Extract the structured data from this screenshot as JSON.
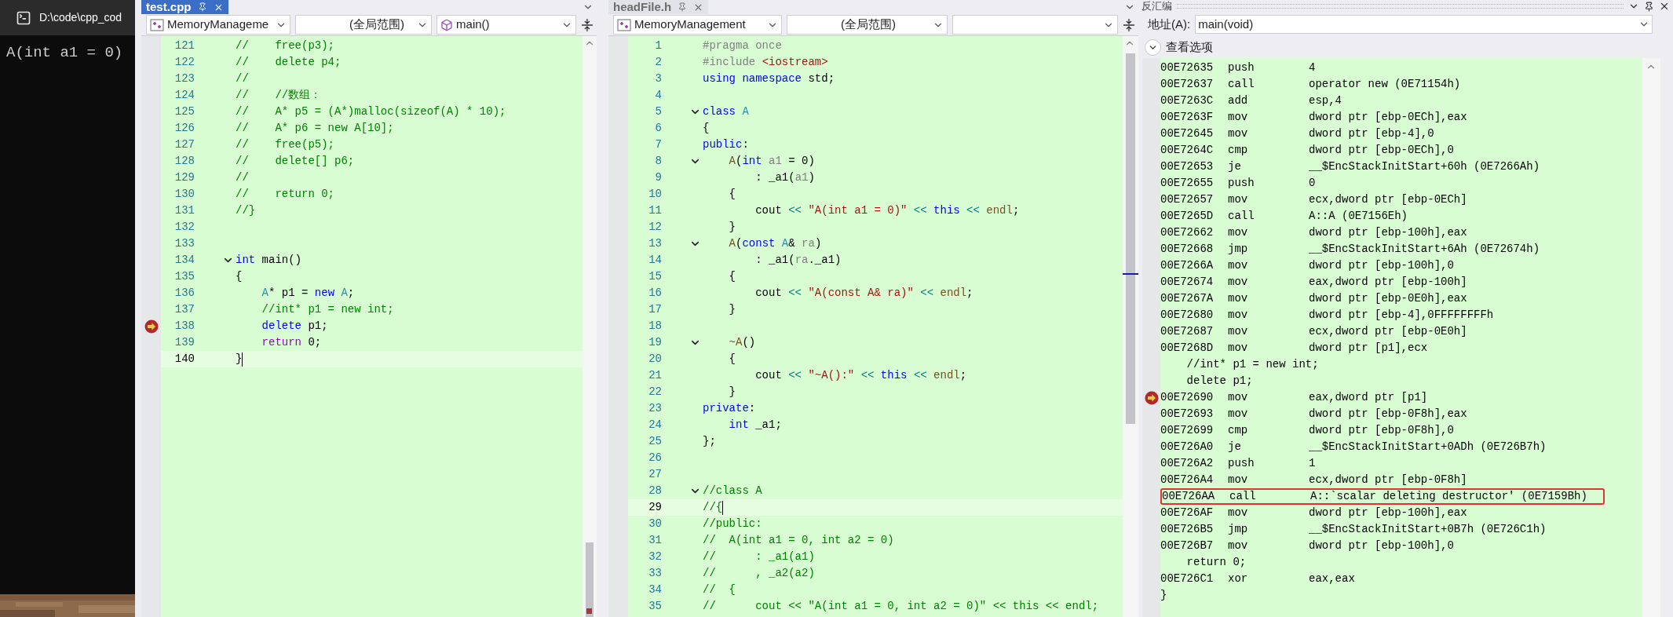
{
  "console": {
    "title": "D:\\code\\cpp_cod",
    "output": "A(int a1 = 0)"
  },
  "editors": [
    {
      "tab": {
        "label": "test.cpp",
        "selected": true
      },
      "nav": [
        {
          "kind": "project",
          "text": "MemoryManageme"
        },
        {
          "kind": "scope",
          "text": "(全局范围)"
        },
        {
          "kind": "function",
          "text": "main()"
        }
      ],
      "lines": [
        {
          "number": "121",
          "fold": false,
          "current": false,
          "selected": false,
          "tokens": [
            {
              "kind": "comment",
              "text": "//    free(p3);"
            }
          ]
        },
        {
          "number": "122",
          "fold": false,
          "current": false,
          "selected": false,
          "tokens": [
            {
              "kind": "comment",
              "text": "//    delete p4;"
            }
          ]
        },
        {
          "number": "123",
          "fold": false,
          "current": false,
          "selected": false,
          "tokens": [
            {
              "kind": "comment",
              "text": "//"
            }
          ]
        },
        {
          "number": "124",
          "fold": false,
          "current": false,
          "selected": false,
          "tokens": [
            {
              "kind": "comment",
              "text": "//    //数组："
            }
          ]
        },
        {
          "number": "125",
          "fold": false,
          "current": false,
          "selected": false,
          "tokens": [
            {
              "kind": "comment",
              "text": "//    A* p5 = (A*)malloc(sizeof(A) * 10);"
            }
          ]
        },
        {
          "number": "126",
          "fold": false,
          "current": false,
          "selected": false,
          "tokens": [
            {
              "kind": "comment",
              "text": "//    A* p6 = new A[10];"
            }
          ]
        },
        {
          "number": "127",
          "fold": false,
          "current": false,
          "selected": false,
          "tokens": [
            {
              "kind": "comment",
              "text": "//    free(p5);"
            }
          ]
        },
        {
          "number": "128",
          "fold": false,
          "current": false,
          "selected": false,
          "tokens": [
            {
              "kind": "comment",
              "text": "//    delete[] p6;"
            }
          ]
        },
        {
          "number": "129",
          "fold": false,
          "current": false,
          "selected": false,
          "tokens": [
            {
              "kind": "comment",
              "text": "//"
            }
          ]
        },
        {
          "number": "130",
          "fold": false,
          "current": false,
          "selected": false,
          "tokens": [
            {
              "kind": "comment",
              "text": "//    return 0;"
            }
          ]
        },
        {
          "number": "131",
          "fold": false,
          "current": false,
          "selected": false,
          "tokens": [
            {
              "kind": "comment",
              "text": "//}"
            }
          ]
        },
        {
          "number": "132",
          "fold": false,
          "current": false,
          "selected": false
        },
        {
          "number": "133",
          "fold": false,
          "current": false,
          "selected": false
        },
        {
          "number": "134",
          "fold": true,
          "current": false,
          "selected": false,
          "tokens": [
            {
              "kind": "keyword",
              "text": "int"
            },
            {
              "kind": "plain",
              "text": " main()"
            }
          ]
        },
        {
          "number": "135",
          "fold": false,
          "current": false,
          "selected": false,
          "tokens": [
            {
              "kind": "plain",
              "text": "{"
            }
          ]
        },
        {
          "number": "136",
          "fold": false,
          "current": false,
          "selected": false,
          "tokens": [
            {
              "kind": "type",
              "text": "    A"
            },
            {
              "kind": "plain",
              "text": "* p1 = "
            },
            {
              "kind": "keyword",
              "text": "new"
            },
            {
              "kind": "type",
              "text": " A"
            },
            {
              "kind": "plain",
              "text": ";"
            }
          ]
        },
        {
          "number": "137",
          "fold": false,
          "current": false,
          "selected": false,
          "tokens": [
            {
              "kind": "comment",
              "text": "    //int* p1 = new int;"
            }
          ]
        },
        {
          "number": "138",
          "fold": false,
          "current": true,
          "selected": false,
          "tokens": [
            {
              "kind": "keyword",
              "text": "    delete"
            },
            {
              "kind": "plain",
              "text": " p1;"
            }
          ]
        },
        {
          "number": "139",
          "fold": false,
          "current": false,
          "selected": false,
          "tokens": [
            {
              "kind": "control",
              "text": "    return"
            },
            {
              "kind": "plain",
              "text": " 0;"
            }
          ]
        },
        {
          "number": "140",
          "fold": false,
          "current": false,
          "selected": true,
          "tokens": [
            {
              "kind": "plain",
              "text": "}"
            }
          ]
        }
      ]
    },
    {
      "tab": {
        "label": "headFile.h",
        "selected": false
      },
      "nav": [
        {
          "kind": "project",
          "text": "MemoryManagement"
        },
        {
          "kind": "scope",
          "text": "(全局范围)"
        }
      ],
      "lines": [
        {
          "number": "1",
          "fold": false,
          "current": false,
          "selected": false,
          "tokens": [
            {
              "kind": "preproc",
              "text": "#pragma once"
            }
          ]
        },
        {
          "number": "2",
          "fold": false,
          "current": false,
          "selected": false,
          "tokens": [
            {
              "kind": "preproc",
              "text": "#include "
            },
            {
              "kind": "string",
              "text": "<iostream>"
            }
          ]
        },
        {
          "number": "3",
          "fold": false,
          "current": false,
          "selected": false,
          "tokens": [
            {
              "kind": "keyword",
              "text": "using namespace"
            },
            {
              "kind": "plain",
              "text": " std;"
            }
          ]
        },
        {
          "number": "4",
          "fold": false,
          "current": false,
          "selected": false
        },
        {
          "number": "5",
          "fold": true,
          "current": false,
          "selected": false,
          "tokens": [
            {
              "kind": "keyword",
              "text": "class"
            },
            {
              "kind": "type",
              "text": " A"
            }
          ]
        },
        {
          "number": "6",
          "fold": false,
          "current": false,
          "selected": false,
          "tokens": [
            {
              "kind": "plain",
              "text": "{"
            }
          ]
        },
        {
          "number": "7",
          "fold": false,
          "current": false,
          "selected": false,
          "tokens": [
            {
              "kind": "keyword",
              "text": "public"
            },
            {
              "kind": "plain",
              "text": ":"
            }
          ]
        },
        {
          "number": "8",
          "fold": true,
          "current": false,
          "selected": false,
          "tokens": [
            {
              "kind": "function",
              "text": "    A"
            },
            {
              "kind": "plain",
              "text": "("
            },
            {
              "kind": "keyword",
              "text": "int"
            },
            {
              "kind": "param",
              "text": " a1"
            },
            {
              "kind": "plain",
              "text": " = 0)"
            }
          ]
        },
        {
          "number": "9",
          "fold": false,
          "current": false,
          "selected": false,
          "tokens": [
            {
              "kind": "plain",
              "text": "        : _a1("
            },
            {
              "kind": "param",
              "text": "a1"
            },
            {
              "kind": "plain",
              "text": ")"
            }
          ]
        },
        {
          "number": "10",
          "fold": false,
          "current": false,
          "selected": false,
          "tokens": [
            {
              "kind": "plain",
              "text": "    {"
            }
          ]
        },
        {
          "number": "11",
          "fold": false,
          "current": false,
          "selected": false,
          "tokens": [
            {
              "kind": "plain",
              "text": "        cout "
            },
            {
              "kind": "operator",
              "text": "<<"
            },
            {
              "kind": "string",
              "text": " \"A(int a1 = 0)\""
            },
            {
              "kind": "operator",
              "text": " <<"
            },
            {
              "kind": "keyword",
              "text": " this"
            },
            {
              "kind": "operator",
              "text": " <<"
            },
            {
              "kind": "function",
              "text": " endl"
            },
            {
              "kind": "plain",
              "text": ";"
            }
          ]
        },
        {
          "number": "12",
          "fold": false,
          "current": false,
          "selected": false,
          "tokens": [
            {
              "kind": "plain",
              "text": "    }"
            }
          ]
        },
        {
          "number": "13",
          "fold": true,
          "current": false,
          "selected": false,
          "tokens": [
            {
              "kind": "function",
              "text": "    A"
            },
            {
              "kind": "plain",
              "text": "("
            },
            {
              "kind": "keyword",
              "text": "const"
            },
            {
              "kind": "type",
              "text": " A"
            },
            {
              "kind": "plain",
              "text": "& "
            },
            {
              "kind": "param",
              "text": "ra"
            },
            {
              "kind": "plain",
              "text": ")"
            }
          ]
        },
        {
          "number": "14",
          "fold": false,
          "current": false,
          "selected": false,
          "tokens": [
            {
              "kind": "plain",
              "text": "        : _a1("
            },
            {
              "kind": "param",
              "text": "ra"
            },
            {
              "kind": "plain",
              "text": "._a1)"
            }
          ]
        },
        {
          "number": "15",
          "fold": false,
          "current": false,
          "selected": false,
          "tokens": [
            {
              "kind": "plain",
              "text": "    {"
            }
          ]
        },
        {
          "number": "16",
          "fold": false,
          "current": false,
          "selected": false,
          "tokens": [
            {
              "kind": "plain",
              "text": "        cout "
            },
            {
              "kind": "operator",
              "text": "<<"
            },
            {
              "kind": "string",
              "text": " \"A(const A& ra)\""
            },
            {
              "kind": "operator",
              "text": " <<"
            },
            {
              "kind": "function",
              "text": " endl"
            },
            {
              "kind": "plain",
              "text": ";"
            }
          ]
        },
        {
          "number": "17",
          "fold": false,
          "current": false,
          "selected": false,
          "tokens": [
            {
              "kind": "plain",
              "text": "    }"
            }
          ]
        },
        {
          "number": "18",
          "fold": false,
          "current": false,
          "selected": false
        },
        {
          "number": "19",
          "fold": true,
          "current": false,
          "selected": false,
          "tokens": [
            {
              "kind": "function",
              "text": "    ~A"
            },
            {
              "kind": "plain",
              "text": "()"
            }
          ]
        },
        {
          "number": "20",
          "fold": false,
          "current": false,
          "selected": false,
          "tokens": [
            {
              "kind": "plain",
              "text": "    {"
            }
          ]
        },
        {
          "number": "21",
          "fold": false,
          "current": false,
          "selected": false,
          "tokens": [
            {
              "kind": "plain",
              "text": "        cout "
            },
            {
              "kind": "operator",
              "text": "<<"
            },
            {
              "kind": "string",
              "text": " \"~A():\""
            },
            {
              "kind": "operator",
              "text": " <<"
            },
            {
              "kind": "keyword",
              "text": " this"
            },
            {
              "kind": "operator",
              "text": " <<"
            },
            {
              "kind": "function",
              "text": " endl"
            },
            {
              "kind": "plain",
              "text": ";"
            }
          ]
        },
        {
          "number": "22",
          "fold": false,
          "current": false,
          "selected": false,
          "tokens": [
            {
              "kind": "plain",
              "text": "    }"
            }
          ]
        },
        {
          "number": "23",
          "fold": false,
          "current": false,
          "selected": false,
          "tokens": [
            {
              "kind": "keyword",
              "text": "private"
            },
            {
              "kind": "plain",
              "text": ":"
            }
          ]
        },
        {
          "number": "24",
          "fold": false,
          "current": false,
          "selected": false,
          "tokens": [
            {
              "kind": "keyword",
              "text": "    int"
            },
            {
              "kind": "plain",
              "text": " _a1;"
            }
          ]
        },
        {
          "number": "25",
          "fold": false,
          "current": false,
          "selected": false,
          "tokens": [
            {
              "kind": "plain",
              "text": "};"
            }
          ]
        },
        {
          "number": "26",
          "fold": false,
          "current": false,
          "selected": false
        },
        {
          "number": "27",
          "fold": false,
          "current": false,
          "selected": false
        },
        {
          "number": "28",
          "fold": true,
          "current": false,
          "selected": false,
          "tokens": [
            {
              "kind": "comment",
              "text": "//class A"
            }
          ]
        },
        {
          "number": "29",
          "fold": false,
          "current": false,
          "selected": true,
          "tokens": [
            {
              "kind": "comment",
              "text": "//{"
            }
          ]
        },
        {
          "number": "30",
          "fold": false,
          "current": false,
          "selected": false,
          "tokens": [
            {
              "kind": "comment",
              "text": "//public:"
            }
          ]
        },
        {
          "number": "31",
          "fold": false,
          "current": false,
          "selected": false,
          "tokens": [
            {
              "kind": "comment",
              "text": "//  A(int a1 = 0, int a2 = 0)"
            }
          ]
        },
        {
          "number": "32",
          "fold": false,
          "current": false,
          "selected": false,
          "tokens": [
            {
              "kind": "comment",
              "text": "//      : _a1(a1)"
            }
          ]
        },
        {
          "number": "33",
          "fold": false,
          "current": false,
          "selected": false,
          "tokens": [
            {
              "kind": "comment",
              "text": "//      , _a2(a2)"
            }
          ]
        },
        {
          "number": "34",
          "fold": false,
          "current": false,
          "selected": false,
          "tokens": [
            {
              "kind": "comment",
              "text": "//  {"
            }
          ]
        },
        {
          "number": "35",
          "fold": false,
          "current": false,
          "selected": false,
          "tokens": [
            {
              "kind": "comment",
              "text": "//      cout << \"A(int a1 = 0, int a2 = 0)\" << this << endl;"
            }
          ]
        }
      ]
    }
  ],
  "disassembly": {
    "title": "反汇编",
    "address_label": "地址(A):",
    "address": "main(void)",
    "options_label": "查看选项",
    "lines": [
      {
        "kind": "asm",
        "address": "00E72635",
        "op": "push",
        "args": "4",
        "current": false,
        "boxed": false
      },
      {
        "kind": "asm",
        "address": "00E72637",
        "op": "call",
        "args": "operator new (0E71154h)",
        "current": false,
        "boxed": false
      },
      {
        "kind": "asm",
        "address": "00E7263C",
        "op": "add",
        "args": "esp,4",
        "current": false,
        "boxed": false
      },
      {
        "kind": "asm",
        "address": "00E7263F",
        "op": "mov",
        "args": "dword ptr [ebp-0ECh],eax",
        "current": false,
        "boxed": false
      },
      {
        "kind": "asm",
        "address": "00E72645",
        "op": "mov",
        "args": "dword ptr [ebp-4],0",
        "current": false,
        "boxed": false
      },
      {
        "kind": "asm",
        "address": "00E7264C",
        "op": "cmp",
        "args": "dword ptr [ebp-0ECh],0",
        "current": false,
        "boxed": false
      },
      {
        "kind": "asm",
        "address": "00E72653",
        "op": "je",
        "args": "__$EncStackInitStart+60h (0E7266Ah)",
        "current": false,
        "boxed": false
      },
      {
        "kind": "asm",
        "address": "00E72655",
        "op": "push",
        "args": "0",
        "current": false,
        "boxed": false
      },
      {
        "kind": "asm",
        "address": "00E72657",
        "op": "mov",
        "args": "ecx,dword ptr [ebp-0ECh]",
        "current": false,
        "boxed": false
      },
      {
        "kind": "asm",
        "address": "00E7265D",
        "op": "call",
        "args": "A::A (0E7156Eh)",
        "current": false,
        "boxed": false
      },
      {
        "kind": "asm",
        "address": "00E72662",
        "op": "mov",
        "args": "dword ptr [ebp-100h],eax",
        "current": false,
        "boxed": false
      },
      {
        "kind": "asm",
        "address": "00E72668",
        "op": "jmp",
        "args": "__$EncStackInitStart+6Ah (0E72674h)",
        "current": false,
        "boxed": false
      },
      {
        "kind": "asm",
        "address": "00E7266A",
        "op": "mov",
        "args": "dword ptr [ebp-100h],0",
        "current": false,
        "boxed": false
      },
      {
        "kind": "asm",
        "address": "00E72674",
        "op": "mov",
        "args": "eax,dword ptr [ebp-100h]",
        "current": false,
        "boxed": false
      },
      {
        "kind": "asm",
        "address": "00E7267A",
        "op": "mov",
        "args": "dword ptr [ebp-0E0h],eax",
        "current": false,
        "boxed": false
      },
      {
        "kind": "asm",
        "address": "00E72680",
        "op": "mov",
        "args": "dword ptr [ebp-4],0FFFFFFFFh",
        "current": false,
        "boxed": false
      },
      {
        "kind": "asm",
        "address": "00E72687",
        "op": "mov",
        "args": "ecx,dword ptr [ebp-0E0h]",
        "current": false,
        "boxed": false
      },
      {
        "kind": "asm",
        "address": "00E7268D",
        "op": "mov",
        "args": "dword ptr [p1],ecx",
        "current": false,
        "boxed": false
      },
      {
        "kind": "source",
        "text": "    //int* p1 = new int;",
        "current": false,
        "boxed": false
      },
      {
        "kind": "source",
        "text": "    delete p1;",
        "current": false,
        "boxed": false
      },
      {
        "kind": "asm",
        "address": "00E72690",
        "op": "mov",
        "args": "eax,dword ptr [p1]",
        "current": true,
        "boxed": false
      },
      {
        "kind": "asm",
        "address": "00E72693",
        "op": "mov",
        "args": "dword ptr [ebp-0F8h],eax",
        "current": false,
        "boxed": false
      },
      {
        "kind": "asm",
        "address": "00E72699",
        "op": "cmp",
        "args": "dword ptr [ebp-0F8h],0",
        "current": false,
        "boxed": false
      },
      {
        "kind": "asm",
        "address": "00E726A0",
        "op": "je",
        "args": "__$EncStackInitStart+0ADh (0E726B7h)",
        "current": false,
        "boxed": false
      },
      {
        "kind": "asm",
        "address": "00E726A2",
        "op": "push",
        "args": "1",
        "current": false,
        "boxed": false
      },
      {
        "kind": "asm",
        "address": "00E726A4",
        "op": "mov",
        "args": "ecx,dword ptr [ebp-0F8h]",
        "current": false,
        "boxed": false
      },
      {
        "kind": "asm",
        "address": "00E726AA",
        "op": "call",
        "args": "A::`scalar deleting destructor' (0E7159Bh)",
        "current": false,
        "boxed": true
      },
      {
        "kind": "asm",
        "address": "00E726AF",
        "op": "mov",
        "args": "dword ptr [ebp-100h],eax",
        "current": false,
        "boxed": false
      },
      {
        "kind": "asm",
        "address": "00E726B5",
        "op": "jmp",
        "args": "__$EncStackInitStart+0B7h (0E726C1h)",
        "current": false,
        "boxed": false
      },
      {
        "kind": "asm",
        "address": "00E726B7",
        "op": "mov",
        "args": "dword ptr [ebp-100h],0",
        "current": false,
        "boxed": false
      },
      {
        "kind": "source",
        "text": "    return 0;",
        "current": false,
        "boxed": false
      },
      {
        "kind": "asm",
        "address": "00E726C1",
        "op": "xor",
        "args": "eax,eax",
        "current": false,
        "boxed": false
      },
      {
        "kind": "source",
        "text": "}",
        "current": false,
        "boxed": false
      }
    ]
  }
}
